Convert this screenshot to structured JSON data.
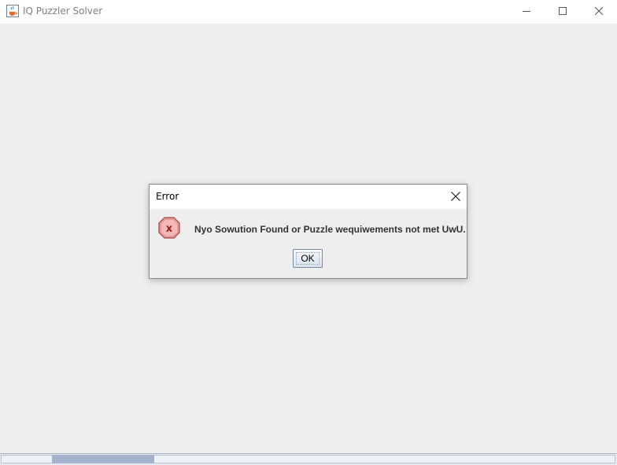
{
  "window": {
    "title": "IQ Puzzler Solver",
    "app_icon": "java-cup-icon",
    "controls": [
      "minimize-icon",
      "maximize-icon",
      "close-icon"
    ]
  },
  "dialog": {
    "title": "Error",
    "icon": "error-icon",
    "message": "Nyo Sowution Found or Puzzle wequiwements not met UwU.",
    "ok_label": "OK"
  },
  "colors": {
    "background": "#eeeeee",
    "titlebar": "#ffffff",
    "error_icon_fill": "#e89a9a",
    "error_icon_mark": "#9b1b1b",
    "scroll_thumb": "#a3b3cd"
  }
}
